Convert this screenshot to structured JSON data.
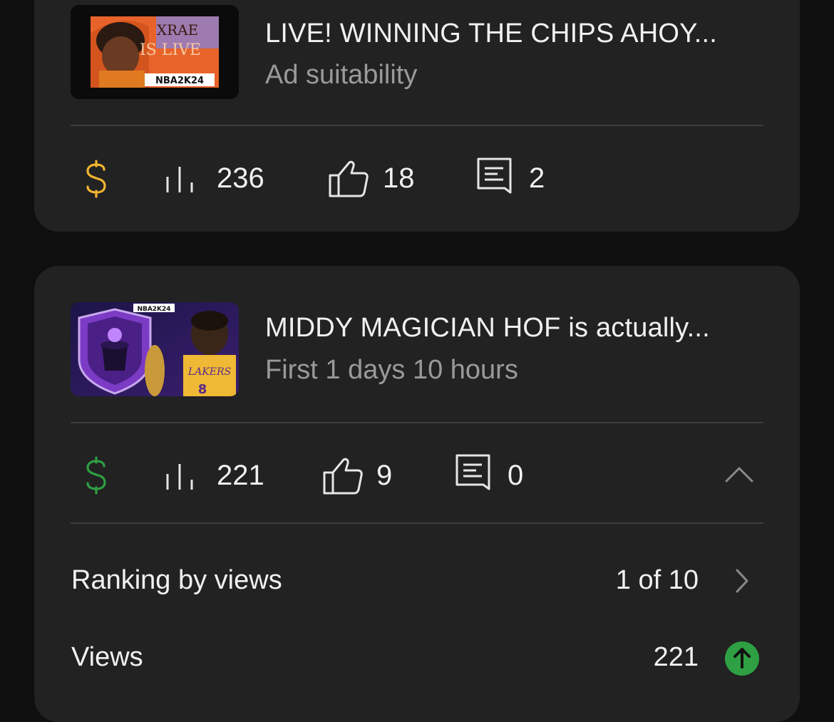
{
  "videos": [
    {
      "title": "LIVE! WINNING THE CHIPS AHOY...",
      "subtitle": "Ad suitability",
      "monetization_icon": "dollar-icon",
      "monetization_color": "#f2b530",
      "views": "236",
      "likes": "18",
      "comments": "2",
      "thumbnail_text": [
        "XRAE",
        "IS LIVE",
        "NBA2K24"
      ]
    },
    {
      "title": "MIDDY MAGICIAN HOF is actually...",
      "subtitle": "First 1 days 10 hours",
      "monetization_icon": "dollar-icon",
      "monetization_color": "#2ea043",
      "views": "221",
      "likes": "9",
      "comments": "0",
      "thumbnail_text": [
        "NBA2K24",
        "LAKERS",
        "8"
      ],
      "expanded": true,
      "details": [
        {
          "label": "Ranking by views",
          "value": "1 of 10",
          "icon": "chevron-right-icon"
        },
        {
          "label": "Views",
          "value": "221",
          "icon": "arrow-up-circle-icon",
          "icon_color": "#2ea043"
        }
      ]
    }
  ]
}
